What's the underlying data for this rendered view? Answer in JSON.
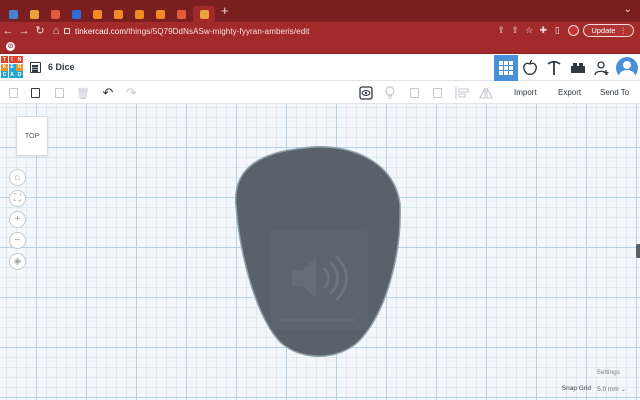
{
  "browser": {
    "tabs": [
      {
        "favicon": "tinkercad-icon",
        "color": "#4a7fd6"
      },
      {
        "favicon": "orange-doc-icon",
        "color": "#e8a33d"
      },
      {
        "favicon": "tinkercad-grid-icon",
        "color": "#e25c3b"
      },
      {
        "favicon": "blue-app-icon",
        "color": "#2f6ed8"
      },
      {
        "favicon": "orange-arrow-icon",
        "color": "#f08a24"
      },
      {
        "favicon": "orange-arrow-icon",
        "color": "#f08a24"
      },
      {
        "favicon": "orange-arrow-icon",
        "color": "#f08a24"
      },
      {
        "favicon": "orange-arrow-icon",
        "color": "#f08a24"
      },
      {
        "favicon": "tinkercad-grid-icon",
        "color": "#e25c3b"
      },
      {
        "favicon": "orange-doc-icon",
        "color": "#e8a33d",
        "active": true
      }
    ],
    "new_tab_label": "+",
    "tab_menu_label": "⌄",
    "url_host": "tinkercad.com",
    "url_path": "/things/5Q79DdNsASw-mighty-fyyran-amberis/edit",
    "update_label": "Update",
    "update_menu": "⋮"
  },
  "app": {
    "logo_letters": [
      "T",
      "I",
      "N",
      "K",
      "E",
      "R",
      "C",
      "A",
      "D"
    ],
    "logo_colors": [
      "#e2462e",
      "#e2462e",
      "#e2462e",
      "#f29324",
      "#27a3d8",
      "#f29324",
      "#27a3d8",
      "#27a3d8",
      "#27a3d8"
    ],
    "design_title": "6 Dice",
    "import_label": "Import",
    "export_label": "Export",
    "send_to_label": "Send To"
  },
  "workplane": {
    "view_cube_label": "TOP",
    "settings_label": "Settings",
    "snap_grid_label": "Snap Grid",
    "snap_grid_value": "5.0 mm ⌄"
  },
  "colors": {
    "shape": "#59626a",
    "shape_edge": "#8fa0aa",
    "selected": "#4a90d9"
  }
}
